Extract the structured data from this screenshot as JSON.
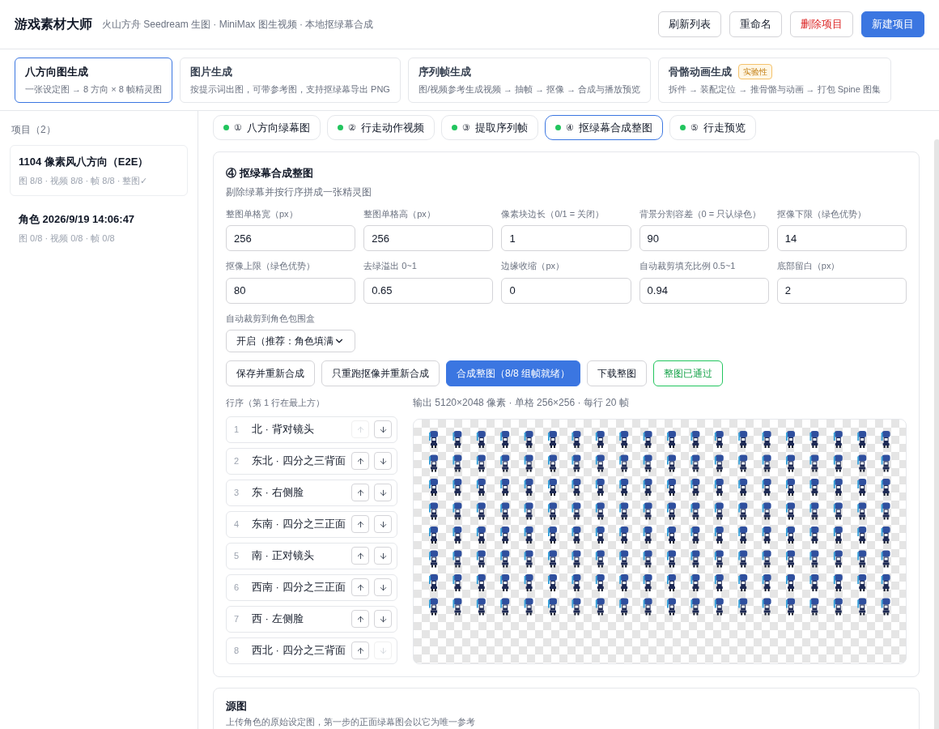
{
  "header": {
    "title": "游戏素材大师",
    "subtitle": "火山方舟 Seedream 生图 · MiniMax 图生视频 · 本地抠绿幕合成",
    "buttons": [
      {
        "label": "刷新列表",
        "kind": "default"
      },
      {
        "label": "重命名",
        "kind": "default"
      },
      {
        "label": "删除项目",
        "kind": "danger"
      },
      {
        "label": "新建项目",
        "kind": "primary"
      }
    ]
  },
  "modes": [
    {
      "title": "八方向图生成",
      "desc": "一张设定图 → 8 方向 × 8 帧精灵图",
      "selected": true
    },
    {
      "title": "图片生成",
      "desc": "按提示词出图，可带参考图，支持抠绿幕导出 PNG",
      "selected": false
    },
    {
      "title": "序列帧生成",
      "desc": "图/视频参考生成视频 → 抽帧 → 抠像 → 合成与播放预览",
      "selected": false
    },
    {
      "title": "骨骼动画生成",
      "badge": "实验性",
      "desc": "拆件 → 装配定位 → 推骨骼与动画 → 打包 Spine 图集",
      "selected": false
    }
  ],
  "sidebar": {
    "heading": "项目（2）",
    "items": [
      {
        "name": "1104 像素风八方向（E2E）",
        "meta": "图 8/8 · 视频 8/8 · 帧 8/8 · 整图✓",
        "selected": true
      },
      {
        "name": "角色 2026/9/19 14:06:47",
        "meta": "图 0/8 · 视频 0/8 · 帧 0/8",
        "selected": false
      }
    ]
  },
  "steps": [
    {
      "icon": "①",
      "label": "八方向绿幕图",
      "color": "#22c55e",
      "selected": false
    },
    {
      "icon": "②",
      "label": "行走动作视频",
      "color": "#22c55e",
      "selected": false
    },
    {
      "icon": "③",
      "label": "提取序列帧",
      "color": "#22c55e",
      "selected": false
    },
    {
      "icon": "④",
      "label": "抠绿幕合成整图",
      "color": "#22c55e",
      "selected": true
    },
    {
      "icon": "⑤",
      "label": "行走预览",
      "color": "#22c55e",
      "selected": false
    }
  ],
  "panel": {
    "title": "④ 抠绿幕合成整图",
    "desc": "剔除绿幕并按行序拼成一张精灵图",
    "fields": [
      {
        "label": "整图单格宽（px）",
        "value": "256"
      },
      {
        "label": "整图单格高（px）",
        "value": "256"
      },
      {
        "label": "像素块边长（0/1 = 关闭）",
        "value": "1"
      },
      {
        "label": "背景分割容差（0 = 只认绿色）",
        "value": "90"
      },
      {
        "label": "抠像下限（绿色优势）",
        "value": "14"
      },
      {
        "label": "抠像上限（绿色优势）",
        "value": "80"
      },
      {
        "label": "去绿溢出 0~1",
        "value": "0.65"
      },
      {
        "label": "边缘收缩（px）",
        "value": "0"
      },
      {
        "label": "自动裁剪填充比例 0.5~1",
        "value": "0.94"
      },
      {
        "label": "底部留白（px）",
        "value": "2"
      }
    ],
    "crop": {
      "label": "自动裁剪到角色包围盒",
      "value": "开启（推荐：角色填满"
    },
    "actions": [
      {
        "label": "保存并重新合成",
        "kind": "default"
      },
      {
        "label": "只重跑抠像并重新合成",
        "kind": "default"
      },
      {
        "label": "合成整图（8/8 组帧就绪）",
        "kind": "primary"
      },
      {
        "label": "下载整图",
        "kind": "default"
      },
      {
        "label": "整图已通过",
        "kind": "success"
      }
    ],
    "order_heading": "行序（第 1 行在最上方）",
    "output_info": "输出 5120×2048 像素 · 单格 256×256 · 每行 20 帧",
    "rows": [
      {
        "index": "1",
        "label": "北 · 背对镜头",
        "up_disabled": true,
        "down_disabled": false
      },
      {
        "index": "2",
        "label": "东北 · 四分之三背面",
        "up_disabled": false,
        "down_disabled": false
      },
      {
        "index": "3",
        "label": "东 · 右侧脸",
        "up_disabled": false,
        "down_disabled": false
      },
      {
        "index": "4",
        "label": "东南 · 四分之三正面",
        "up_disabled": false,
        "down_disabled": false
      },
      {
        "index": "5",
        "label": "南 · 正对镜头",
        "up_disabled": false,
        "down_disabled": false
      },
      {
        "index": "6",
        "label": "西南 · 四分之三正面",
        "up_disabled": false,
        "down_disabled": false
      },
      {
        "index": "7",
        "label": "西 · 左侧脸",
        "up_disabled": false,
        "down_disabled": false
      },
      {
        "index": "8",
        "label": "西北 · 四分之三背面",
        "up_disabled": false,
        "down_disabled": true
      }
    ]
  },
  "source": {
    "title": "源图",
    "desc": "上传角色的原始设定图，第一步的正面绿幕图会以它为唯一参考"
  }
}
